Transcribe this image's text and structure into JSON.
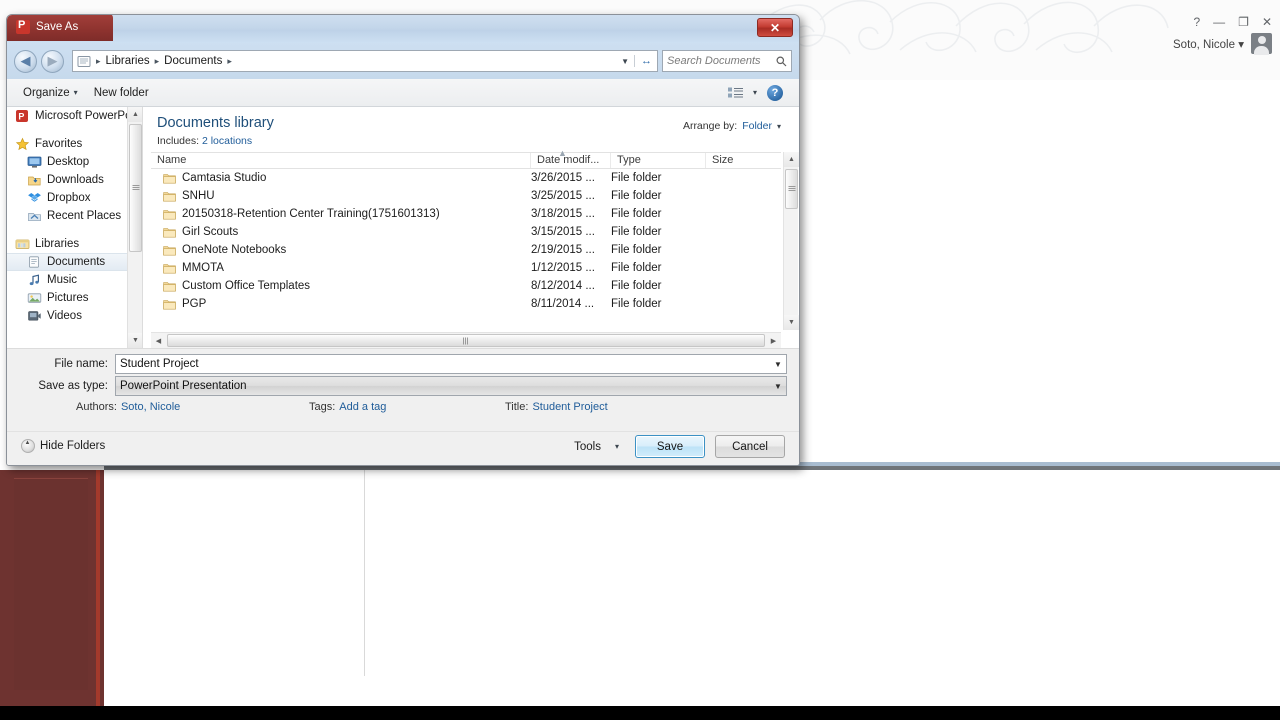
{
  "background_app": {
    "name": "Microsoft PowerPoint",
    "user_name": "Soto, Nicole",
    "user_caret": "▾",
    "window_buttons": [
      {
        "name": "help",
        "glyph": "?"
      },
      {
        "name": "minimize",
        "glyph": "—"
      },
      {
        "name": "restore",
        "glyph": "❐"
      },
      {
        "name": "close",
        "glyph": "✕"
      }
    ]
  },
  "dialog": {
    "title": "Save As",
    "app_icon": "powerpoint-icon",
    "close_glyph": "✕",
    "address": {
      "back_glyph": "◀",
      "forward_glyph": "▶",
      "folder_icon": "library-icon",
      "crumbs": [
        "Libraries",
        "Documents"
      ],
      "crumb_separator": "▸",
      "trailing_separator": "▸",
      "dropdown_glyph": "▼",
      "refresh_glyph": "↔"
    },
    "search": {
      "placeholder": "Search Documents",
      "value": "",
      "icon": "search-icon"
    },
    "toolbar": {
      "organize_label": "Organize",
      "organize_caret": "▾",
      "new_folder_label": "New folder",
      "view_icon": "view-list-icon",
      "view_caret": "▾",
      "help_glyph": "?"
    },
    "nav_pane": {
      "header": "Microsoft PowerPo",
      "groups": [
        {
          "label": "Favorites",
          "icon": "star-icon",
          "items": [
            {
              "label": "Desktop",
              "icon": "desktop-icon"
            },
            {
              "label": "Downloads",
              "icon": "downloads-icon"
            },
            {
              "label": "Dropbox",
              "icon": "dropbox-icon"
            },
            {
              "label": "Recent Places",
              "icon": "recent-places-icon"
            }
          ]
        },
        {
          "label": "Libraries",
          "icon": "libraries-icon",
          "items": [
            {
              "label": "Documents",
              "icon": "documents-icon",
              "selected": true
            },
            {
              "label": "Music",
              "icon": "music-icon"
            },
            {
              "label": "Pictures",
              "icon": "pictures-icon"
            },
            {
              "label": "Videos",
              "icon": "videos-icon"
            }
          ]
        }
      ]
    },
    "library": {
      "title": "Documents library",
      "includes_label": "Includes:",
      "includes_value": "2 locations",
      "arrange_label": "Arrange by:",
      "arrange_value": "Folder",
      "arrange_caret": "▾"
    },
    "columns": [
      {
        "key": "name",
        "label": "Name"
      },
      {
        "key": "date",
        "label": "Date modif..."
      },
      {
        "key": "type",
        "label": "Type"
      },
      {
        "key": "size",
        "label": "Size"
      }
    ],
    "files": [
      {
        "name": "Camtasia Studio",
        "date": "3/26/2015 ...",
        "type": "File folder",
        "size": ""
      },
      {
        "name": "SNHU",
        "date": "3/25/2015 ...",
        "type": "File folder",
        "size": ""
      },
      {
        "name": "20150318-Retention Center Training(1751601313)",
        "date": "3/18/2015 ...",
        "type": "File folder",
        "size": ""
      },
      {
        "name": "Girl Scouts",
        "date": "3/15/2015 ...",
        "type": "File folder",
        "size": ""
      },
      {
        "name": "OneNote Notebooks",
        "date": "2/19/2015 ...",
        "type": "File folder",
        "size": ""
      },
      {
        "name": "MMOTA",
        "date": "1/12/2015 ...",
        "type": "File folder",
        "size": ""
      },
      {
        "name": "Custom Office Templates",
        "date": "8/12/2014 ...",
        "type": "File folder",
        "size": ""
      },
      {
        "name": "PGP",
        "date": "8/11/2014 ...",
        "type": "File folder",
        "size": ""
      }
    ],
    "form": {
      "file_name_label": "File name:",
      "file_name_value": "Student Project",
      "save_as_type_label": "Save as type:",
      "save_as_type_value": "PowerPoint Presentation",
      "dropdown_caret": "▼",
      "authors_label": "Authors:",
      "authors_value": "Soto, Nicole",
      "tags_label": "Tags:",
      "tags_value": "Add a tag",
      "title_label": "Title:",
      "title_value": "Student Project"
    },
    "footer": {
      "hide_folders_label": "Hide Folders",
      "tools_label": "Tools",
      "tools_caret": "▾",
      "save_label": "Save",
      "cancel_label": "Cancel"
    }
  },
  "colors": {
    "accent_blue": "#1f5c99",
    "library_title": "#1f4f7a",
    "slide_pane_red": "#6e3330",
    "titlebar_tab_red": "#8e332f",
    "save_focus_border": "#3c91c4"
  }
}
